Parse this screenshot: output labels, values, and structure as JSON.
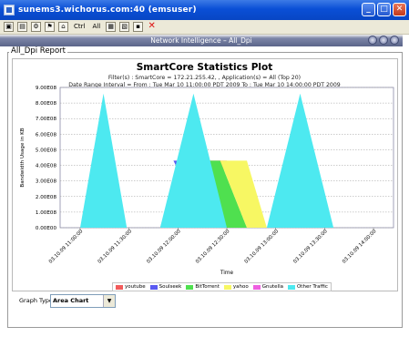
{
  "window": {
    "title": "sunems3.wichorus.com:40 (emsuser)",
    "minimize_glyph": "_",
    "maximize_glyph": "□",
    "close_glyph": "✕"
  },
  "toolbar": {
    "icons": [
      "app-icon",
      "toolbar-icon-1",
      "toolbar-icon-2",
      "toolbar-icon-3",
      "toolbar-icon-4",
      "toolbar-icon-5"
    ],
    "ctrl_label": "Ctrl",
    "all_label": "All",
    "close_glyph": "✕"
  },
  "inner_window": {
    "title": "Network Intelligence – All_Dpi"
  },
  "report": {
    "panel_title": "All_Dpi Report",
    "graph_type_label": "Graph Type",
    "graph_type_value": "Area Chart",
    "dropdown_arrow": "▼"
  },
  "chart_data": {
    "type": "area",
    "title": "SmartCore Statistics Plot",
    "subtitle1": "Filter(s) : SmartCore = 172.21.255.42, , Application(s) = All (Top 20)",
    "subtitle2": "Date Range Interval = From : Tue Mar 10 11:00:00 PDT 2009 To : Tue Mar 10 14:00:00 PDT 2009",
    "xlabel": "Time",
    "ylabel": "Bandwidth Usage in KB",
    "ylim": [
      0,
      900000000
    ],
    "yticks": [
      "0.00E00",
      "1.00E08",
      "2.00E08",
      "3.00E08",
      "4.00E08",
      "5.00E08",
      "6.00E08",
      "7.00E08",
      "8.00E08",
      "9.00E08"
    ],
    "x_ticks": [
      "03.10.09 11:00:00",
      "03.10.09 11:30:00",
      "03.10.09 12:00:00",
      "03.10.09 12:30:00",
      "03.10.09 13:00:00",
      "03.10.09 13:30:00",
      "03.10.09 14:00:00"
    ],
    "grid": true,
    "legend_position": "bottom",
    "series": [
      {
        "name": "youtube",
        "color": "#f25b5b",
        "shape": [
          [
            0.3,
            0
          ],
          [
            0.36,
            430000000
          ],
          [
            0.5,
            430000000
          ],
          [
            0.44,
            0
          ]
        ]
      },
      {
        "name": "Soulseek",
        "color": "#5a5af2",
        "shape": [
          [
            0.34,
            430000000
          ],
          [
            0.42,
            430000000
          ],
          [
            0.5,
            0
          ],
          [
            0.44,
            0
          ]
        ]
      },
      {
        "name": "BitTorrent",
        "color": "#4fe04f",
        "shape": [
          [
            0.42,
            430000000
          ],
          [
            0.48,
            430000000
          ],
          [
            0.56,
            0
          ],
          [
            0.5,
            0
          ]
        ]
      },
      {
        "name": "yahoo",
        "color": "#f7f763",
        "shape": [
          [
            0.48,
            430000000
          ],
          [
            0.56,
            430000000
          ],
          [
            0.62,
            0
          ],
          [
            0.56,
            0
          ]
        ]
      },
      {
        "name": "Gnutella",
        "color": "#ee5fe0",
        "shape": []
      },
      {
        "name": "Other Traffic",
        "color": "#4de9f0",
        "shape": [
          [
            0.06,
            0
          ],
          [
            0.13,
            860000000
          ],
          [
            0.2,
            0
          ],
          [
            0.3,
            0
          ],
          [
            0.4,
            860000000
          ],
          [
            0.5,
            0
          ],
          [
            0.62,
            0
          ],
          [
            0.72,
            860000000
          ],
          [
            0.82,
            0
          ]
        ]
      }
    ]
  }
}
